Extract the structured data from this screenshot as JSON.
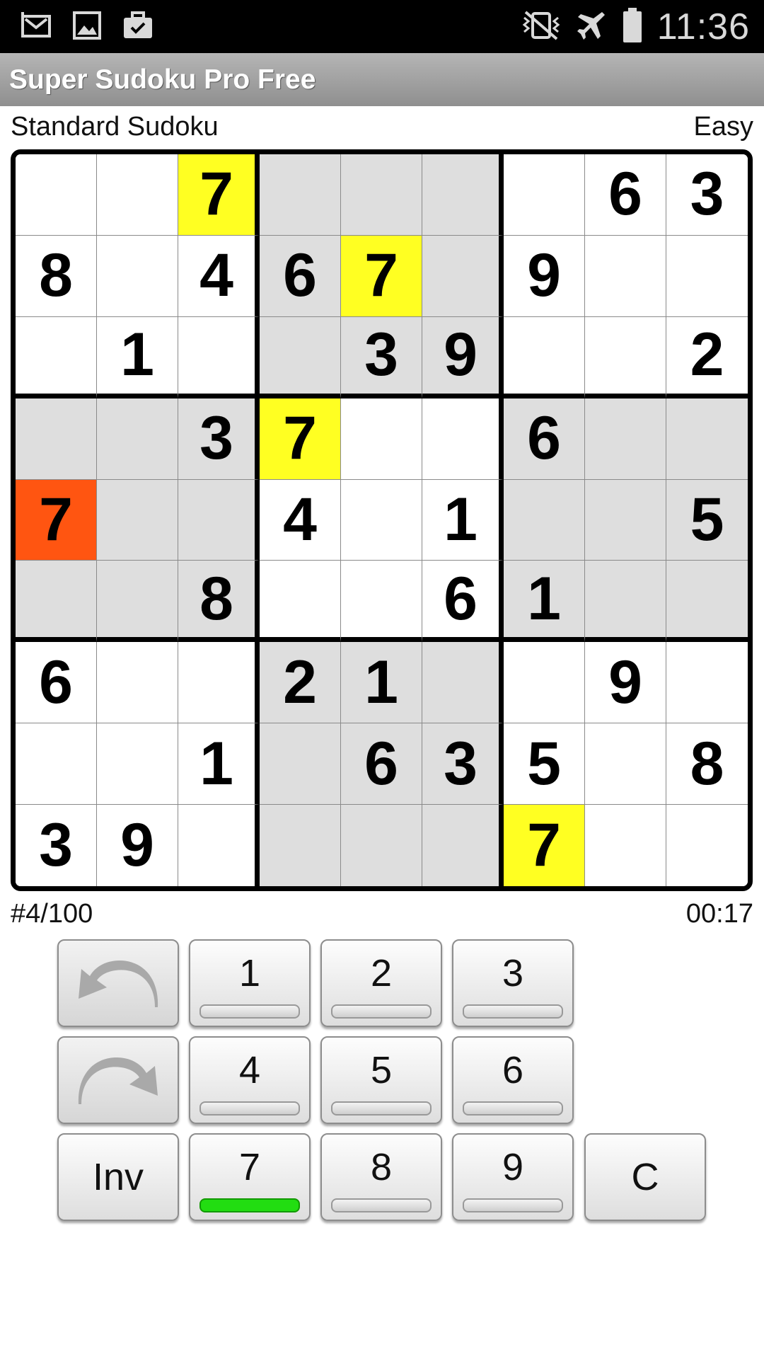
{
  "status_bar": {
    "time": "11:36",
    "left_icons": [
      "gmail-icon",
      "gallery-icon",
      "briefcase-check-icon"
    ],
    "right_icons": [
      "mute-vibrate-icon",
      "airplane-mode-icon",
      "battery-icon"
    ]
  },
  "app_title": "Super Sudoku Pro Free",
  "puzzle": {
    "type": "Standard Sudoku",
    "difficulty": "Easy",
    "number": "#4/100",
    "timer": "00:17"
  },
  "board": {
    "rows": [
      [
        "",
        "",
        "7",
        "",
        "",
        "",
        "",
        "6",
        "3"
      ],
      [
        "8",
        "",
        "4",
        "6",
        "7",
        "",
        "9",
        "",
        ""
      ],
      [
        "",
        "1",
        "",
        "",
        "3",
        "9",
        "",
        "",
        "2"
      ],
      [
        "",
        "",
        "3",
        "7",
        "",
        "",
        "6",
        "",
        ""
      ],
      [
        "7",
        "",
        "",
        "4",
        "",
        "1",
        "",
        "",
        "5"
      ],
      [
        "",
        "",
        "8",
        "",
        "",
        "6",
        "1",
        "",
        ""
      ],
      [
        "6",
        "",
        "",
        "2",
        "1",
        "",
        "",
        "9",
        ""
      ],
      [
        "",
        "",
        "1",
        "",
        "6",
        "3",
        "5",
        "",
        "8"
      ],
      [
        "3",
        "9",
        "",
        "",
        "",
        "",
        "7",
        "",
        ""
      ]
    ],
    "selected_cell": {
      "row": 5,
      "col": 1
    },
    "highlighted_value": "7",
    "colors": {
      "white": "#ffffff",
      "shaded": "#dedede",
      "highlight": "#ffff22",
      "selected": "#ff5511"
    }
  },
  "keypad": {
    "undo_icon": "undo-arrow-icon",
    "redo_icon": "redo-arrow-icon",
    "numbers": [
      "1",
      "2",
      "3",
      "4",
      "5",
      "6",
      "7",
      "8",
      "9"
    ],
    "active_number": "7",
    "invert_label": "Inv",
    "clear_label": "C",
    "active_color": "#22dd11"
  }
}
